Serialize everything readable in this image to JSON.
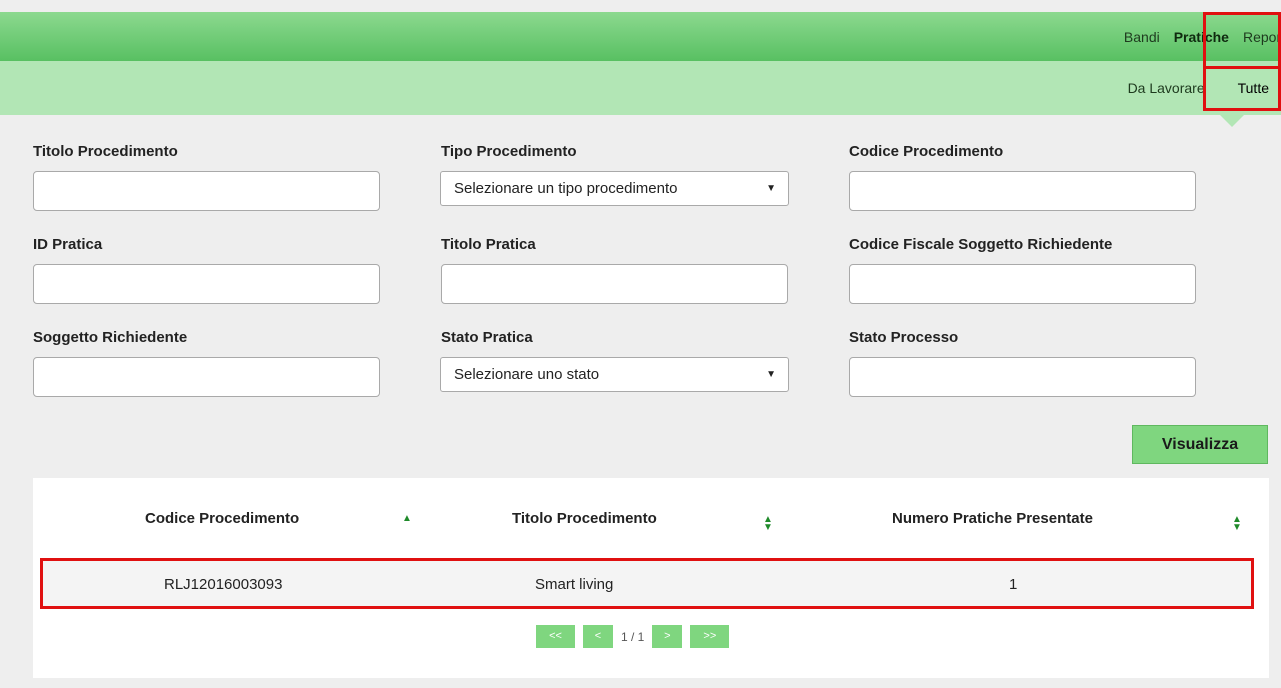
{
  "nav": {
    "main": [
      "Bandi",
      "Pratiche",
      "Report"
    ],
    "sub": [
      "Da Lavorare",
      "Tutte"
    ]
  },
  "form": {
    "titolo_procedimento": {
      "label": "Titolo Procedimento",
      "value": ""
    },
    "tipo_procedimento": {
      "label": "Tipo Procedimento",
      "selected": "Selezionare un tipo procedimento"
    },
    "codice_procedimento": {
      "label": "Codice Procedimento",
      "value": ""
    },
    "id_pratica": {
      "label": "ID Pratica",
      "value": ""
    },
    "titolo_pratica": {
      "label": "Titolo Pratica",
      "value": ""
    },
    "codice_fiscale": {
      "label": "Codice Fiscale Soggetto Richiedente",
      "value": ""
    },
    "soggetto_richiedente": {
      "label": "Soggetto Richiedente",
      "value": ""
    },
    "stato_pratica": {
      "label": "Stato Pratica",
      "selected": "Selezionare uno stato"
    },
    "stato_processo": {
      "label": "Stato Processo",
      "value": ""
    },
    "submit_label": "Visualizza"
  },
  "table": {
    "columns": [
      "Codice Procedimento",
      "Titolo Procedimento",
      "Numero Pratiche Presentate"
    ],
    "rows": [
      [
        "RLJ12016003093",
        "Smart living",
        "1"
      ]
    ]
  },
  "pagination": {
    "first": "<<",
    "prev": "<",
    "info": "1 / 1",
    "next": ">",
    "last": ">>"
  },
  "colors": {
    "header_green": "#58c062",
    "subheader_green": "#b2e6b5",
    "button_green": "#7fd67f",
    "highlight_red": "#e01010"
  }
}
